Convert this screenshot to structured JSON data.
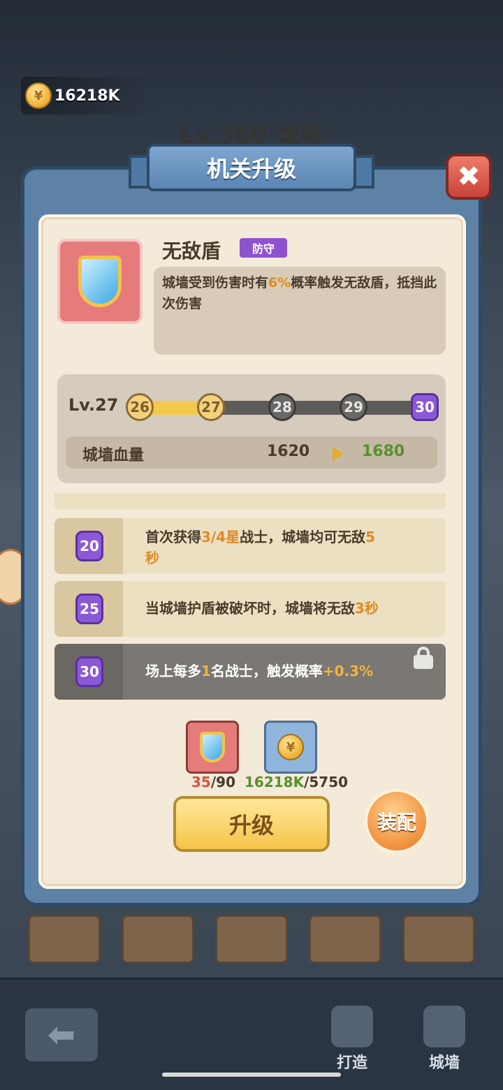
{
  "top": {
    "coin_amount": "16218K",
    "coin_glyph": "¥",
    "level_title": "Lv.360 城墙"
  },
  "panel": {
    "title": "机关升级",
    "close_glyph": "✖"
  },
  "skill": {
    "name": "无敌盾",
    "tag": "防守",
    "desc_part1": "城墙受到伤害时有",
    "desc_highlight": "6%",
    "desc_part2": "概率触发无敌盾，抵挡此次伤害"
  },
  "level": {
    "label": "Lv.27",
    "progress": 0.25,
    "nodes": [
      "26",
      "27",
      "28",
      "29",
      "30"
    ],
    "stat_name": "城墙血量",
    "stat_old": "1620",
    "stat_new": "1680"
  },
  "rows": [
    {
      "level": "20",
      "text_a": "首次获得",
      "hl1": "3/4星",
      "text_b": "战士，城墙均可无敌",
      "hl2": "5",
      "text_c": "秒"
    },
    {
      "level": "25",
      "text_a": "当城墙护盾被破坏时，城墙将无敌",
      "hl1": "3秒"
    },
    {
      "level": "30",
      "text_a": "场上每多",
      "hl1": "1",
      "text_b": "名战士，触发概率",
      "hl2": "+0.3%"
    }
  ],
  "cost": {
    "item_have": "35",
    "item_need": "/90",
    "coin_have": "16218K",
    "coin_need": "/5750"
  },
  "buttons": {
    "upgrade": "升级",
    "equip": "装配"
  },
  "nav": {
    "back_glyph": "⬅",
    "forge": "打造",
    "wall": "城墙"
  },
  "colors": {
    "highlight": "#e08a24",
    "green": "#58902d",
    "purple": "#8c59d6"
  }
}
